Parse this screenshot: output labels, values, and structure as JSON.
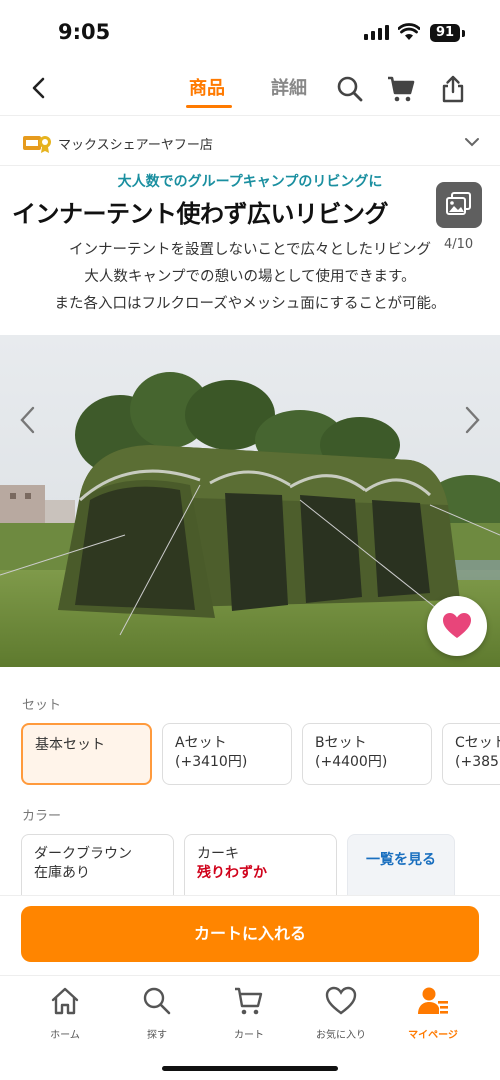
{
  "status_bar": {
    "time": "9:05",
    "battery": "91"
  },
  "header": {
    "tab_product": "商品",
    "tab_detail": "詳細",
    "back_icon": "back-arrow-icon",
    "search_icon": "search-icon",
    "cart_icon": "cart-icon",
    "share_icon": "share-icon"
  },
  "store": {
    "name": "マックスシェアーヤフー店"
  },
  "banner": {
    "subtitle": "大人数でのグループキャンプのリビングに",
    "title": "インナーテント使わず広いリビング",
    "line1": "インナーテントを設置しないことで広々としたリビング",
    "line2": "大人数キャンプでの憩いの場として使用できます。",
    "line3": "また各入口はフルクローズやメッシュ面にすることが可能。"
  },
  "gallery": {
    "counter": "4/10"
  },
  "set_section": {
    "label": "セット",
    "options": [
      {
        "name": "基本セット",
        "price": "",
        "selected": true
      },
      {
        "name": "Aセット",
        "price": "(+3410円)",
        "selected": false
      },
      {
        "name": "Bセット",
        "price": "(+4400円)",
        "selected": false
      },
      {
        "name": "Cセット",
        "price": "(+385",
        "selected": false
      }
    ]
  },
  "color_section": {
    "label": "カラー",
    "options": [
      {
        "name": "ダークブラウン",
        "stock": "在庫あり"
      },
      {
        "name": "カーキ",
        "stock": "残りわずか"
      }
    ],
    "view_all": "一覧を見る"
  },
  "cart_button": {
    "label": "カートに入れる"
  },
  "bottom_nav": {
    "items": [
      {
        "label": "ホーム",
        "icon": "home-icon"
      },
      {
        "label": "探す",
        "icon": "search-icon"
      },
      {
        "label": "カート",
        "icon": "cart-icon"
      },
      {
        "label": "お気に入り",
        "icon": "heart-icon"
      },
      {
        "label": "マイページ",
        "icon": "user-icon"
      }
    ]
  },
  "colors": {
    "accent": "#ff7a00",
    "cart_button": "#ff8500",
    "heart": "#e8457a",
    "banner_subtitle": "#1a8fa0"
  }
}
